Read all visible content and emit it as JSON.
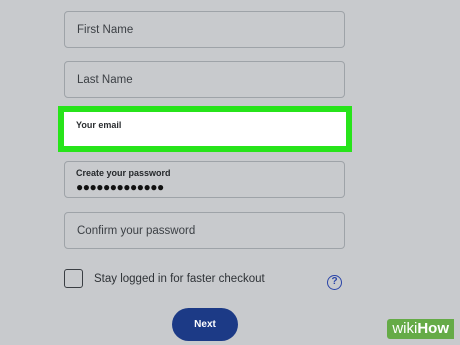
{
  "form": {
    "first_name_placeholder": "First Name",
    "last_name_placeholder": "Last Name",
    "email_label": "Your email",
    "password_label": "Create your password",
    "password_value": "●●●●●●●●●●●●●",
    "confirm_password_placeholder": "Confirm your password",
    "stay_logged_in_label": "Stay logged in for faster checkout",
    "stay_logged_in_checked": false,
    "help_icon_glyph": "?",
    "next_button_label": "Next"
  },
  "watermark": {
    "wiki": "wiki",
    "how": "How"
  },
  "colors": {
    "background": "#c8cacd",
    "highlight": "#27e41a",
    "button": "#1c3a86",
    "help_icon": "#2a44a8"
  },
  "icons": {
    "help": "help-icon"
  }
}
